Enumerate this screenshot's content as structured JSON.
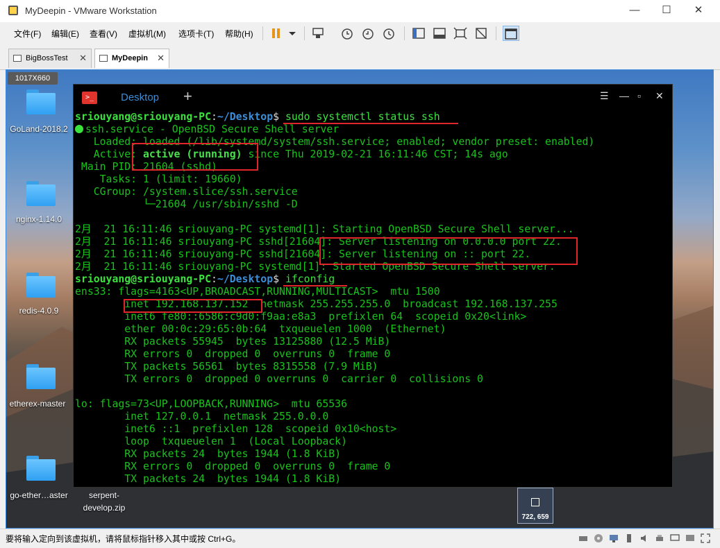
{
  "window": {
    "title": "MyDeepin - VMware Workstation",
    "min": "—",
    "max": "☐",
    "close": "✕"
  },
  "menu": [
    "文件(F)",
    "编辑(E)",
    "查看(V)",
    "虚拟机(M)",
    "选项卡(T)",
    "帮助(H)"
  ],
  "tabs": [
    {
      "label": "BigBossTest",
      "close": "✕"
    },
    {
      "label": "MyDeepin",
      "close": "✕"
    }
  ],
  "vm": {
    "resolution_badge": "1017X660"
  },
  "desktop_icons": [
    "GoLand-2018.2",
    "nginx-1.14.0",
    "redis-4.0.9",
    "etherex-master",
    "go-ether…aster",
    "serpent-develop.zip"
  ],
  "floating_icon_label": "722, 659",
  "terminal": {
    "tab": "Desktop",
    "prompt_user": "sriouyang@sriouyang-PC",
    "prompt_path": "~/Desktop",
    "command1": " sudo systemctl status ssh",
    "command2": " ifconfig",
    "status_line1": "ssh.service - OpenBSD Secure Shell server",
    "loaded": "   Loaded: loaded (/lib/systemd/system/ssh.service; enabled; vendor preset: enabled)",
    "active_label": "   Active: ",
    "active_value": "active (running)",
    "active_rest": " since Thu 2019-02-21 16:11:46 CST; 14s ago",
    "main_pid": " Main PID: 21604 (sshd)",
    "tasks": "    Tasks: 1 (limit: 19660)",
    "cgroup": "   CGroup: /system.slice/ssh.service",
    "cgroup2": "           └─21604 /usr/sbin/sshd -D",
    "log1": "2月  21 16:11:46 sriouyang-PC systemd[1]: Starting OpenBSD Secure Shell server...",
    "log2": "2月  21 16:11:46 sriouyang-PC sshd[21604]: Server listening on 0.0.0.0 port 22.",
    "log3": "2月  21 16:11:46 sriouyang-PC sshd[21604]: Server listening on :: port 22.",
    "log4": "2月  21 16:11:46 sriouyang-PC systemd[1]: Started OpenBSD Secure Shell server.",
    "ens33": "ens33: flags=4163<UP,BROADCAST,RUNNING,MULTICAST>  mtu 1500",
    "inet": "        inet 192.168.137.152  netmask 255.255.255.0  broadcast 192.168.137.255",
    "inet6": "        inet6 fe80::6586:c9d0:f9aa:e8a3  prefixlen 64  scopeid 0x20<link>",
    "ether": "        ether 00:0c:29:65:0b:64  txqueuelen 1000  (Ethernet)",
    "rx1": "        RX packets 55945  bytes 13125880 (12.5 MiB)",
    "rx2": "        RX errors 0  dropped 0  overruns 0  frame 0",
    "tx1": "        TX packets 56561  bytes 8315558 (7.9 MiB)",
    "tx2": "        TX errors 0  dropped 0 overruns 0  carrier 0  collisions 0",
    "blank": "",
    "lo": "lo: flags=73<UP,LOOPBACK,RUNNING>  mtu 65536",
    "lo_inet": "        inet 127.0.0.1  netmask 255.0.0.0",
    "lo_inet6": "        inet6 ::1  prefixlen 128  scopeid 0x10<host>",
    "lo_loop": "        loop  txqueuelen 1  (Local Loopback)",
    "lo_rx1": "        RX packets 24  bytes 1944 (1.8 KiB)",
    "lo_rx2": "        RX errors 0  dropped 0  overruns 0  frame 0",
    "lo_tx1": "        TX packets 24  bytes 1944 (1.8 KiB)"
  },
  "status_bar": "要将输入定向到该虚拟机，请将鼠标指针移入其中或按 Ctrl+G。",
  "colors": {
    "annotation": "#e0262a",
    "terminal_green": "#19c31c",
    "path_blue": "#3b8ed8",
    "frame_blue": "#3a8be0"
  }
}
